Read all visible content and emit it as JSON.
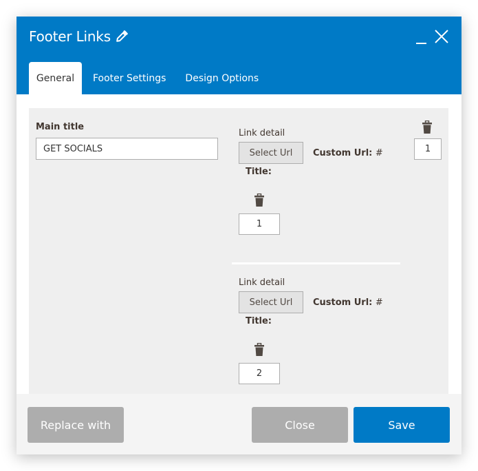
{
  "modal": {
    "title": "Footer Links",
    "title_icon": "pencil-icon",
    "controls": {
      "minimize_icon": "minimize-icon",
      "close_icon": "close-icon"
    }
  },
  "tabs": [
    {
      "label": "General",
      "active": true
    },
    {
      "label": "Footer Settings",
      "active": false
    },
    {
      "label": "Design Options",
      "active": false
    }
  ],
  "general": {
    "main_title_label": "Main title",
    "main_title_value": "GET SOCIALS",
    "group_order_value": "1",
    "links": [
      {
        "label": "Link detail",
        "select_url_label": "Select Url",
        "custom_url_label": "Custom Url:",
        "custom_url_value": "#",
        "title_label": "Title:",
        "order_value": "1"
      },
      {
        "label": "Link detail",
        "select_url_label": "Select Url",
        "custom_url_label": "Custom Url:",
        "custom_url_value": "#",
        "title_label": "Title:",
        "order_value": "2"
      }
    ]
  },
  "footer": {
    "replace_label": "Replace with",
    "close_label": "Close",
    "save_label": "Save"
  },
  "colors": {
    "primary": "#007ac6",
    "secondary_button": "#adadad",
    "panel_bg": "#efefef",
    "label_text": "#41362f"
  }
}
